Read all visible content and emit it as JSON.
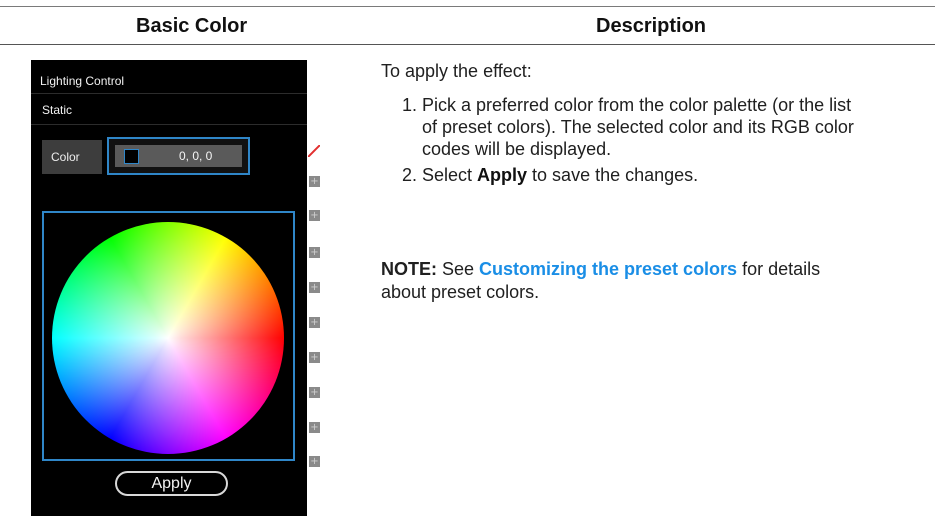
{
  "table": {
    "header_basic": "Basic Color",
    "header_desc": "Description"
  },
  "panel": {
    "title": "Lighting Control",
    "mode": "Static",
    "color_label": "Color",
    "rgb_value": "0, 0, 0",
    "apply_label": "Apply",
    "accent_color": "#2f86c8",
    "preset_count": 9
  },
  "description": {
    "intro": "To apply the effect:",
    "step1_num": "1.",
    "step1_text": "Pick a preferred color from the color palette (or the list of preset colors). The selected color and its RGB color codes will be displayed.",
    "step2_num": "2.",
    "step2_pre": "Select ",
    "step2_bold": "Apply",
    "step2_post": " to save the changes.",
    "note_label": "NOTE:",
    "note_pre": " See ",
    "note_link": "Customizing the preset colors",
    "note_post": " for details about preset colors.",
    "link_color": "#1a8ee6"
  }
}
